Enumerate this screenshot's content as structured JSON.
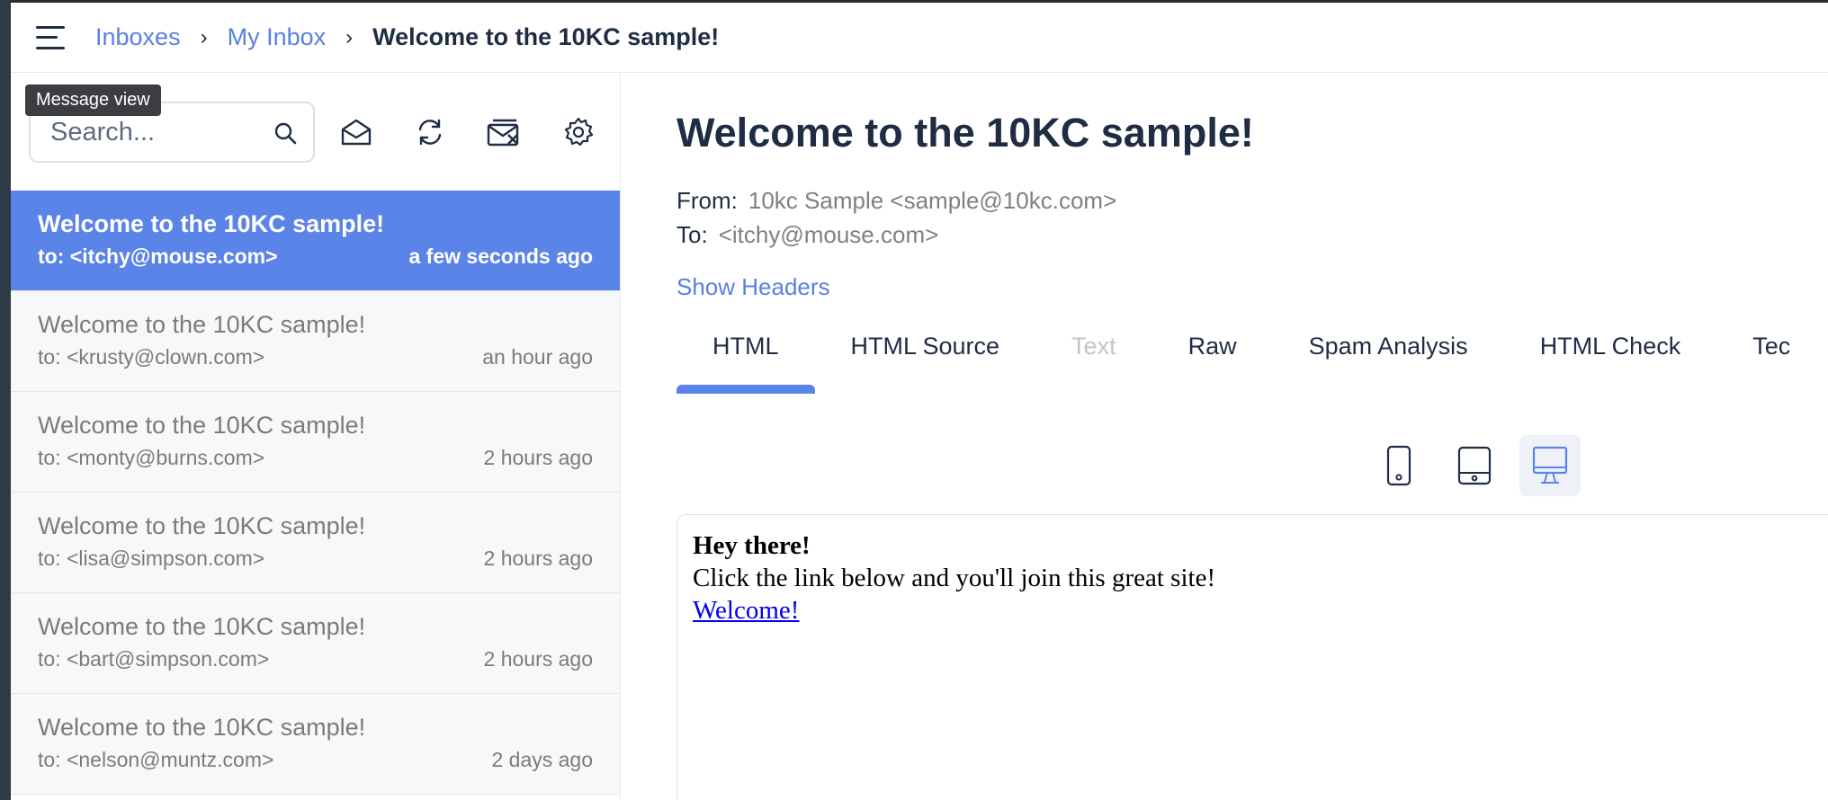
{
  "breadcrumb": {
    "inboxes": "Inboxes",
    "my_inbox": "My Inbox",
    "current": "Welcome to the 10KC sample!",
    "separator": "›"
  },
  "toolbar": {
    "tooltip": "Message view",
    "search_placeholder": "Search..."
  },
  "messages": [
    {
      "subject": "Welcome to the 10KC sample!",
      "to": "to: <itchy@mouse.com>",
      "time": "a few seconds ago",
      "selected": true
    },
    {
      "subject": "Welcome to the 10KC sample!",
      "to": "to: <krusty@clown.com>",
      "time": "an hour ago"
    },
    {
      "subject": "Welcome to the 10KC sample!",
      "to": "to: <monty@burns.com>",
      "time": "2 hours ago"
    },
    {
      "subject": "Welcome to the 10KC sample!",
      "to": "to: <lisa@simpson.com>",
      "time": "2 hours ago"
    },
    {
      "subject": "Welcome to the 10KC sample!",
      "to": "to: <bart@simpson.com>",
      "time": "2 hours ago"
    },
    {
      "subject": "Welcome to the 10KC sample!",
      "to": "to: <nelson@muntz.com>",
      "time": "2 days ago"
    }
  ],
  "message": {
    "title": "Welcome to the 10KC sample!",
    "from_label": "From:",
    "from_value": "10kc Sample <sample@10kc.com>",
    "to_label": "To:",
    "to_value": "<itchy@mouse.com>",
    "show_headers": "Show Headers"
  },
  "tabs": [
    {
      "label": "HTML",
      "active": true
    },
    {
      "label": "HTML Source"
    },
    {
      "label": "Text",
      "disabled": true
    },
    {
      "label": "Raw"
    },
    {
      "label": "Spam Analysis"
    },
    {
      "label": "HTML Check"
    },
    {
      "label": "Tec"
    }
  ],
  "preview": {
    "greeting": "Hey there!",
    "body": "Click the link below and you'll join this great site!",
    "link": "Welcome!"
  },
  "colors": {
    "accent": "#5b84e8",
    "link": "#5b7fe3",
    "text": "#1f2d44",
    "muted": "#7b7b7b"
  }
}
